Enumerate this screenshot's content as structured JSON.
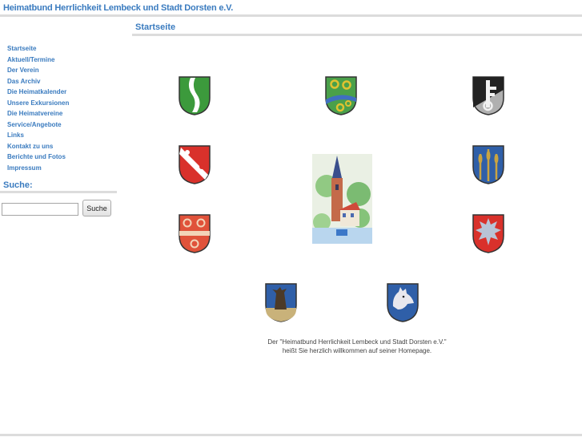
{
  "header": {
    "site_title": "Heimatbund Herrlichkeit Lembeck und Stadt Dorsten e.V."
  },
  "main": {
    "page_title": "Startseite",
    "welcome_line1": "Der \"Heimatbund Herrlichkeit Lembeck und Stadt Dorsten e.V.\"",
    "welcome_line2": "heißt Sie herzlich willkommen auf seiner Homepage."
  },
  "sidebar": {
    "nav": [
      {
        "label": "Startseite"
      },
      {
        "label": "Aktuell/Termine"
      },
      {
        "label": "Der Verein"
      },
      {
        "label": "Das Archiv"
      },
      {
        "label": "Die Heimatkalender"
      },
      {
        "label": "Unsere Exkursionen"
      },
      {
        "label": "Die Heimatvereine"
      },
      {
        "label": "Service/Angebote"
      },
      {
        "label": "Links"
      },
      {
        "label": "Kontakt zu uns"
      },
      {
        "label": "Berichte und Fotos"
      },
      {
        "label": "Impressum"
      }
    ],
    "search": {
      "title": "Suche:",
      "input_value": "",
      "button_label": "Suche"
    }
  },
  "colors": {
    "accent": "#3a7bbf",
    "rule": "#dcdcdc"
  }
}
